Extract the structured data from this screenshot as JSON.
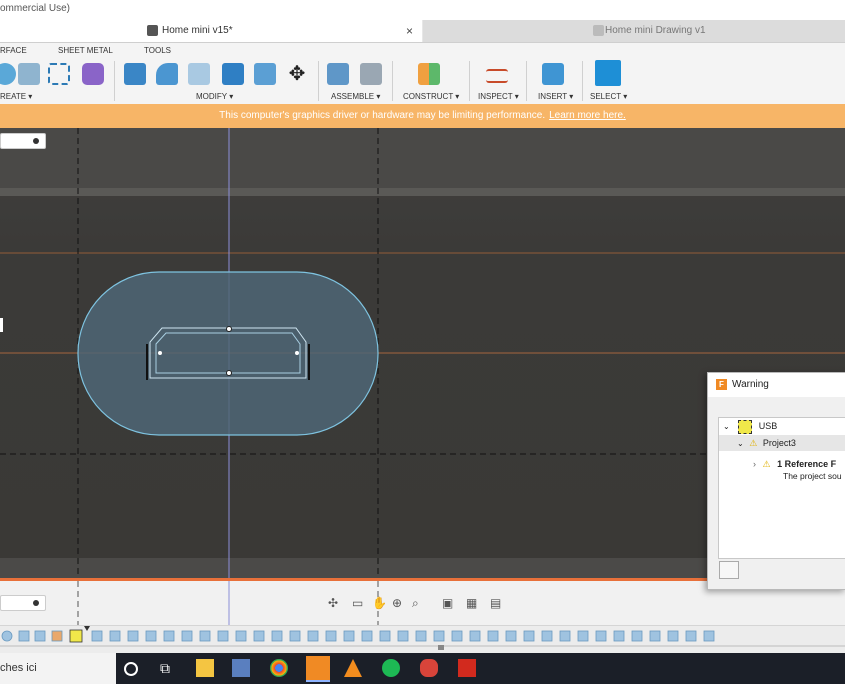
{
  "window": {
    "title_fragment": "ommercial Use)"
  },
  "tabs": [
    {
      "label": "Home mini v15*",
      "active": true,
      "close": "×"
    },
    {
      "label": "Home mini Drawing v1",
      "active": false
    }
  ],
  "workspace_tabs": [
    "RFACE",
    "SHEET METAL",
    "TOOLS"
  ],
  "toolbar_groups": [
    {
      "label": "REATE ▾"
    },
    {
      "label": "MODIFY ▾"
    },
    {
      "label": "ASSEMBLE ▾"
    },
    {
      "label": "CONSTRUCT ▾"
    },
    {
      "label": "INSPECT ▾"
    },
    {
      "label": "INSERT ▾"
    },
    {
      "label": "SELECT ▾"
    }
  ],
  "banner": {
    "text": "This computer's graphics driver or hardware may be limiting performance.",
    "link": "Learn more here."
  },
  "dialog": {
    "title": "Warning",
    "tree": {
      "root": "USB",
      "child": "Project3",
      "item_title": "1 Reference F",
      "item_desc": "The project sou"
    }
  },
  "taskbar": {
    "search_text": "ches ici"
  },
  "colors": {
    "accent": "#f08a24",
    "banner": "#f7b567",
    "sketch_profile": "#7ec3e0",
    "select_blue": "#1e8fd6"
  }
}
